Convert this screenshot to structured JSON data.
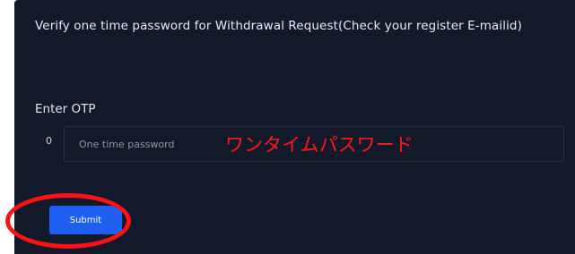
{
  "form": {
    "title": "Verify one time password for Withdrawal Request(Check your register E-mailid)",
    "otp_label": "Enter OTP",
    "input_prefix": "0",
    "otp_placeholder": "One time password",
    "otp_value": "",
    "submit_label": "Submit"
  },
  "annotation": {
    "text": "ワンタイムパスワード",
    "color": "#ff1a1a"
  },
  "colors": {
    "panel_background": "#12192b",
    "submit_button": "#1e5ef0",
    "highlight_circle": "#ff1212"
  }
}
